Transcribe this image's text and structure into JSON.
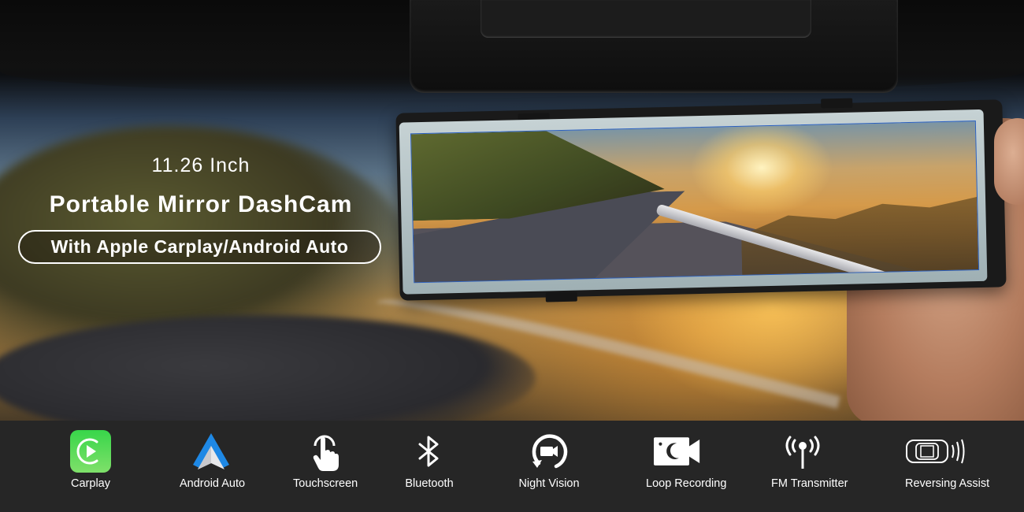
{
  "hero": {
    "size_text": "11.26 Inch",
    "title": "Portable Mirror DashCam",
    "tagline": "With Apple Carplay/Android Auto"
  },
  "features": [
    {
      "label": "Carplay",
      "icon": "carplay-icon"
    },
    {
      "label": "Android Auto",
      "icon": "android-auto-icon"
    },
    {
      "label": "Touchscreen",
      "icon": "touch-icon"
    },
    {
      "label": "Bluetooth",
      "icon": "bluetooth-icon"
    },
    {
      "label": "Night Vision",
      "icon": "night-vision-icon"
    },
    {
      "label": "Loop Recording",
      "icon": "loop-recording-icon"
    },
    {
      "label": "FM Transmitter",
      "icon": "fm-transmitter-icon"
    },
    {
      "label": "Reversing Assist",
      "icon": "reversing-assist-icon"
    }
  ],
  "colors": {
    "feature_bar_bg": "#262626",
    "carplay_green": "#3ecf4a",
    "android_blue": "#1e88e5",
    "text": "#ffffff"
  }
}
